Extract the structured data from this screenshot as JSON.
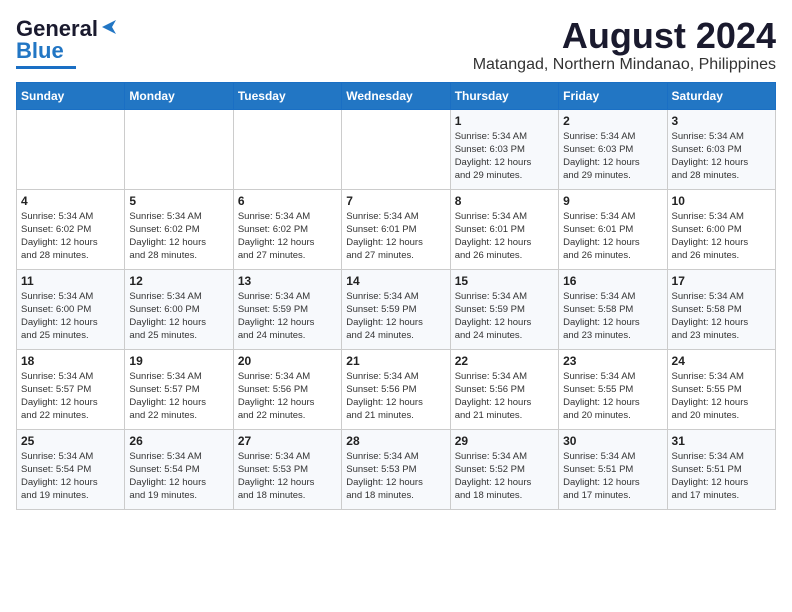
{
  "header": {
    "logo_general": "General",
    "logo_blue": "Blue",
    "month_year": "August 2024",
    "location": "Matangad, Northern Mindanao, Philippines"
  },
  "days_of_week": [
    "Sunday",
    "Monday",
    "Tuesday",
    "Wednesday",
    "Thursday",
    "Friday",
    "Saturday"
  ],
  "weeks": [
    [
      {
        "day": "",
        "info": ""
      },
      {
        "day": "",
        "info": ""
      },
      {
        "day": "",
        "info": ""
      },
      {
        "day": "",
        "info": ""
      },
      {
        "day": "1",
        "info": "Sunrise: 5:34 AM\nSunset: 6:03 PM\nDaylight: 12 hours\nand 29 minutes."
      },
      {
        "day": "2",
        "info": "Sunrise: 5:34 AM\nSunset: 6:03 PM\nDaylight: 12 hours\nand 29 minutes."
      },
      {
        "day": "3",
        "info": "Sunrise: 5:34 AM\nSunset: 6:03 PM\nDaylight: 12 hours\nand 28 minutes."
      }
    ],
    [
      {
        "day": "4",
        "info": "Sunrise: 5:34 AM\nSunset: 6:02 PM\nDaylight: 12 hours\nand 28 minutes."
      },
      {
        "day": "5",
        "info": "Sunrise: 5:34 AM\nSunset: 6:02 PM\nDaylight: 12 hours\nand 28 minutes."
      },
      {
        "day": "6",
        "info": "Sunrise: 5:34 AM\nSunset: 6:02 PM\nDaylight: 12 hours\nand 27 minutes."
      },
      {
        "day": "7",
        "info": "Sunrise: 5:34 AM\nSunset: 6:01 PM\nDaylight: 12 hours\nand 27 minutes."
      },
      {
        "day": "8",
        "info": "Sunrise: 5:34 AM\nSunset: 6:01 PM\nDaylight: 12 hours\nand 26 minutes."
      },
      {
        "day": "9",
        "info": "Sunrise: 5:34 AM\nSunset: 6:01 PM\nDaylight: 12 hours\nand 26 minutes."
      },
      {
        "day": "10",
        "info": "Sunrise: 5:34 AM\nSunset: 6:00 PM\nDaylight: 12 hours\nand 26 minutes."
      }
    ],
    [
      {
        "day": "11",
        "info": "Sunrise: 5:34 AM\nSunset: 6:00 PM\nDaylight: 12 hours\nand 25 minutes."
      },
      {
        "day": "12",
        "info": "Sunrise: 5:34 AM\nSunset: 6:00 PM\nDaylight: 12 hours\nand 25 minutes."
      },
      {
        "day": "13",
        "info": "Sunrise: 5:34 AM\nSunset: 5:59 PM\nDaylight: 12 hours\nand 24 minutes."
      },
      {
        "day": "14",
        "info": "Sunrise: 5:34 AM\nSunset: 5:59 PM\nDaylight: 12 hours\nand 24 minutes."
      },
      {
        "day": "15",
        "info": "Sunrise: 5:34 AM\nSunset: 5:59 PM\nDaylight: 12 hours\nand 24 minutes."
      },
      {
        "day": "16",
        "info": "Sunrise: 5:34 AM\nSunset: 5:58 PM\nDaylight: 12 hours\nand 23 minutes."
      },
      {
        "day": "17",
        "info": "Sunrise: 5:34 AM\nSunset: 5:58 PM\nDaylight: 12 hours\nand 23 minutes."
      }
    ],
    [
      {
        "day": "18",
        "info": "Sunrise: 5:34 AM\nSunset: 5:57 PM\nDaylight: 12 hours\nand 22 minutes."
      },
      {
        "day": "19",
        "info": "Sunrise: 5:34 AM\nSunset: 5:57 PM\nDaylight: 12 hours\nand 22 minutes."
      },
      {
        "day": "20",
        "info": "Sunrise: 5:34 AM\nSunset: 5:56 PM\nDaylight: 12 hours\nand 22 minutes."
      },
      {
        "day": "21",
        "info": "Sunrise: 5:34 AM\nSunset: 5:56 PM\nDaylight: 12 hours\nand 21 minutes."
      },
      {
        "day": "22",
        "info": "Sunrise: 5:34 AM\nSunset: 5:56 PM\nDaylight: 12 hours\nand 21 minutes."
      },
      {
        "day": "23",
        "info": "Sunrise: 5:34 AM\nSunset: 5:55 PM\nDaylight: 12 hours\nand 20 minutes."
      },
      {
        "day": "24",
        "info": "Sunrise: 5:34 AM\nSunset: 5:55 PM\nDaylight: 12 hours\nand 20 minutes."
      }
    ],
    [
      {
        "day": "25",
        "info": "Sunrise: 5:34 AM\nSunset: 5:54 PM\nDaylight: 12 hours\nand 19 minutes."
      },
      {
        "day": "26",
        "info": "Sunrise: 5:34 AM\nSunset: 5:54 PM\nDaylight: 12 hours\nand 19 minutes."
      },
      {
        "day": "27",
        "info": "Sunrise: 5:34 AM\nSunset: 5:53 PM\nDaylight: 12 hours\nand 18 minutes."
      },
      {
        "day": "28",
        "info": "Sunrise: 5:34 AM\nSunset: 5:53 PM\nDaylight: 12 hours\nand 18 minutes."
      },
      {
        "day": "29",
        "info": "Sunrise: 5:34 AM\nSunset: 5:52 PM\nDaylight: 12 hours\nand 18 minutes."
      },
      {
        "day": "30",
        "info": "Sunrise: 5:34 AM\nSunset: 5:51 PM\nDaylight: 12 hours\nand 17 minutes."
      },
      {
        "day": "31",
        "info": "Sunrise: 5:34 AM\nSunset: 5:51 PM\nDaylight: 12 hours\nand 17 minutes."
      }
    ]
  ]
}
